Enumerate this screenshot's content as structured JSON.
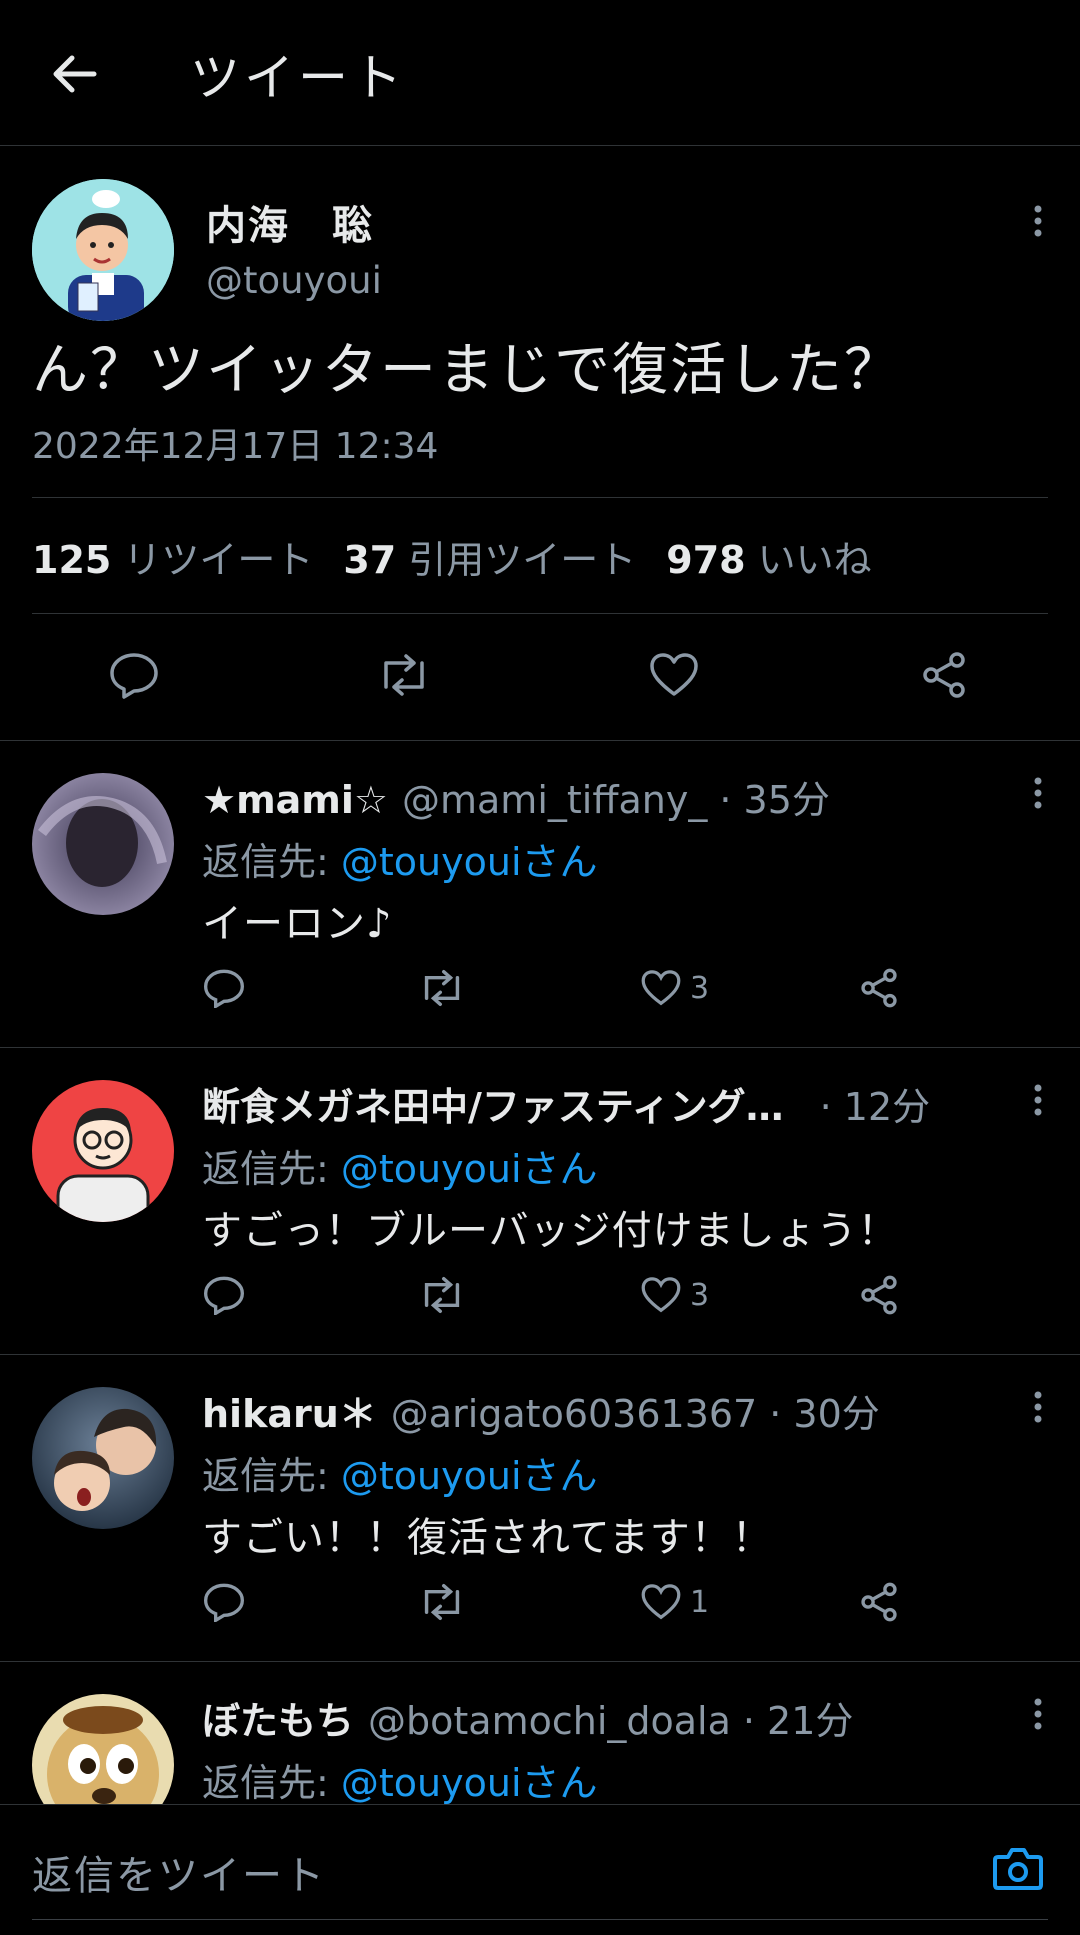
{
  "header": {
    "title": "ツイート"
  },
  "main_tweet": {
    "name": "内海　聡",
    "handle": "@touyoui",
    "text": "ん？ツイッターまじで復活した？",
    "date": "2022年12月17日 12:34",
    "stats": [
      {
        "count": "125",
        "label": "リツイート"
      },
      {
        "count": "37",
        "label": "引用ツイート"
      },
      {
        "count": "978",
        "label": "いいね"
      }
    ]
  },
  "replies": [
    {
      "name": "★mami☆",
      "handle": "@mami_tiffany_",
      "time": "· 35分",
      "to_label": "返信先:",
      "to_handle": "@touyouiさん",
      "text": "イーロン♪",
      "likes": "3"
    },
    {
      "name": "断食メガネ田中/ファスティング…",
      "handle": "",
      "time": "· 12分",
      "to_label": "返信先:",
      "to_handle": "@touyouiさん",
      "text": "すごっ！ブルーバッジ付けましょう！",
      "likes": "3"
    },
    {
      "name": "hikaru＊",
      "handle": "@arigato60361367",
      "time": "· 30分",
      "to_label": "返信先:",
      "to_handle": "@touyouiさん",
      "text": "すごい！！復活されてます！！",
      "likes": "1"
    },
    {
      "name": "ぼたもち",
      "handle": "@botamochi_doala",
      "time": "· 21分",
      "to_label": "返信先:",
      "to_handle": "@touyouiさん",
      "text": "",
      "likes": ""
    }
  ],
  "compose": {
    "placeholder": "返信をツイート"
  },
  "colors": {
    "background": "#000000",
    "text": "#e7e9ea",
    "muted": "#8b98a5",
    "accent": "#1d9bf0"
  }
}
